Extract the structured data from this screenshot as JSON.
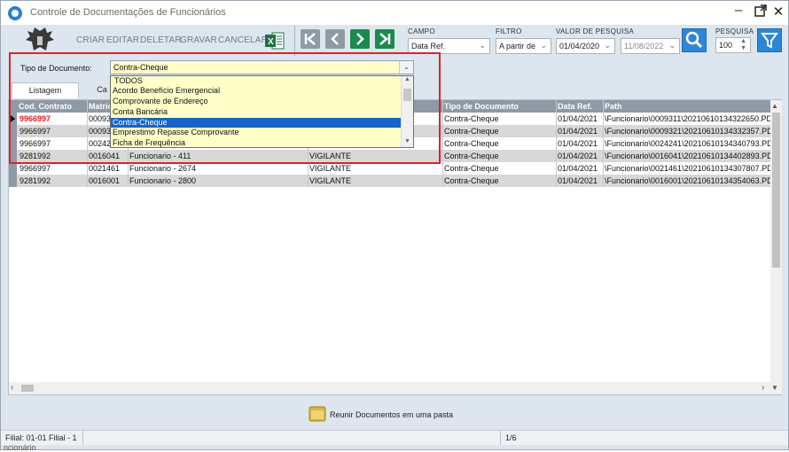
{
  "window": {
    "title": "Controle de Documentações de Funcionários"
  },
  "toolbar": {
    "buttons": [
      "CRIAR",
      "EDITAR",
      "DELETAR",
      "GRAVAR",
      "CANCELAR"
    ],
    "campo_label": "CAMPO",
    "campo_value": "Data Ref.",
    "filtro_label": "FILTRO",
    "filtro_value": "A partir de",
    "valor_label": "VALOR DE PESQUISA",
    "valor_from": "01/04/2020",
    "valor_to": "11/08/2022",
    "pesquisa_label": "PESQUISA",
    "pesquisa_value": "100"
  },
  "tipo": {
    "label": "Tipo de Documento:",
    "selected": "Contra-Cheque",
    "options": [
      "TODOS",
      "Acordo Benefício Emergencial",
      "Comprovante de Endereço",
      "Conta Bancária",
      "Contra-Cheque",
      "Emprestimo Repasse Comprovante",
      "Ficha de Frequência"
    ],
    "selected_index": 4
  },
  "tabs": [
    "Listagem",
    "Ca"
  ],
  "grid": {
    "headers": [
      "Cod. Contrato",
      "Matric",
      "",
      "",
      "Tipo de Documento",
      "Data Ref.",
      "Path"
    ],
    "rows": [
      {
        "cod": "9966997",
        "mat": "00093",
        "nome": "",
        "cargo": "",
        "tipo": "Contra-Cheque",
        "data": "01/04/2021",
        "path": "\\Funcionario\\0009311\\20210610134322650.PD"
      },
      {
        "cod": "9966997",
        "mat": "00093",
        "nome": "",
        "cargo": "",
        "tipo": "Contra-Cheque",
        "data": "01/04/2021",
        "path": "\\Funcionario\\0009321\\20210610134332357.PD"
      },
      {
        "cod": "9966997",
        "mat": "00242",
        "nome": "",
        "cargo": "",
        "tipo": "Contra-Cheque",
        "data": "01/04/2021",
        "path": "\\Funcionario\\0024241\\20210610134340793.PD"
      },
      {
        "cod": "9281992",
        "mat": "0016041",
        "nome": "Funcionario - 411",
        "cargo": "VIGILANTE",
        "tipo": "Contra-Cheque",
        "data": "01/04/2021",
        "path": "\\Funcionario\\0016041\\20210610134402893.PD"
      },
      {
        "cod": "9966997",
        "mat": "0021461",
        "nome": "Funcionario - 2674",
        "cargo": "VIGILANTE",
        "tipo": "Contra-Cheque",
        "data": "01/04/2021",
        "path": "\\Funcionario\\0021461\\20210610134307807.PD"
      },
      {
        "cod": "9281992",
        "mat": "0016001",
        "nome": "Funcionario - 2800",
        "cargo": "VIGILANTE",
        "tipo": "Contra-Cheque",
        "data": "01/04/2021",
        "path": "\\Funcionario\\0016001\\20210610134354063.PD"
      }
    ]
  },
  "bottom": {
    "gather_label": "Reunir Documentos em uma pasta"
  },
  "status": {
    "filial": "Filial: 01-01 Filial - 1",
    "page": "1/6",
    "cut": "ncionário"
  },
  "colors": {
    "accent": "#2e86d6",
    "highlight_border": "#e0202a",
    "selected_row_text": "#e0202a"
  }
}
